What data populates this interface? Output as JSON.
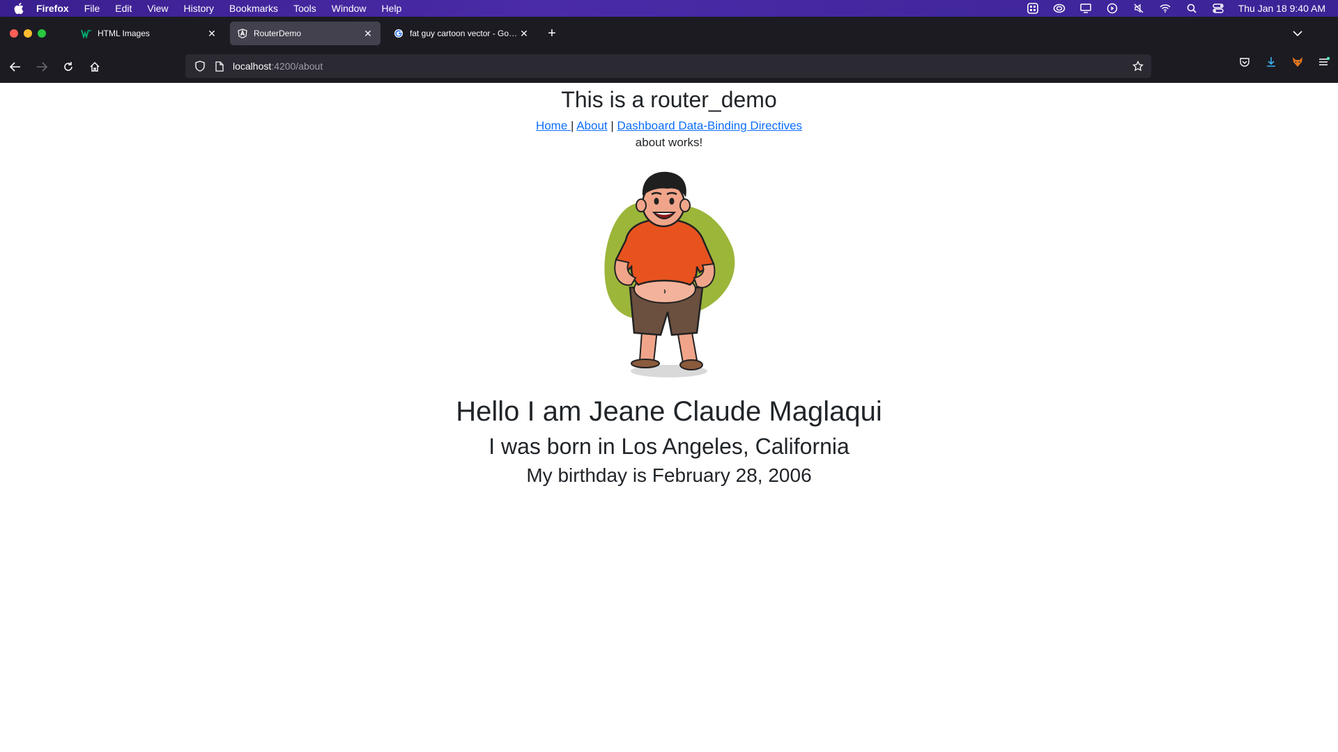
{
  "menubar": {
    "items": [
      "Firefox",
      "File",
      "Edit",
      "View",
      "History",
      "Bookmarks",
      "Tools",
      "Window",
      "Help"
    ],
    "clock": "Thu Jan 18  9:40 AM"
  },
  "tabs": [
    {
      "title": "HTML Images",
      "favicon": "w3schools-icon",
      "active": false
    },
    {
      "title": "RouterDemo",
      "favicon": "angular-icon",
      "active": true
    },
    {
      "title": "fat guy cartoon vector - Google",
      "favicon": "google-icon",
      "active": false
    }
  ],
  "urlbar": {
    "host": "localhost",
    "path": ":4200/about"
  },
  "page": {
    "heading": "This is a router_demo",
    "links": {
      "home": "Home ",
      "sep1": " | ",
      "about": "About",
      "sep2": " | ",
      "dashboard": "Dashboard Data-Binding Directives"
    },
    "works": "about works!",
    "name": "Hello I am Jeane Claude Maglaqui",
    "born": "I was born in Los Angeles, California",
    "birthday": "My birthday is February 28, 2006"
  },
  "colors": {
    "menubar": "#3a1f8f",
    "chrome": "#1c1b22",
    "active_tab": "#42414d",
    "link": "#0d6efd",
    "shirt": "#e8521f",
    "blob": "#9cb63a"
  }
}
